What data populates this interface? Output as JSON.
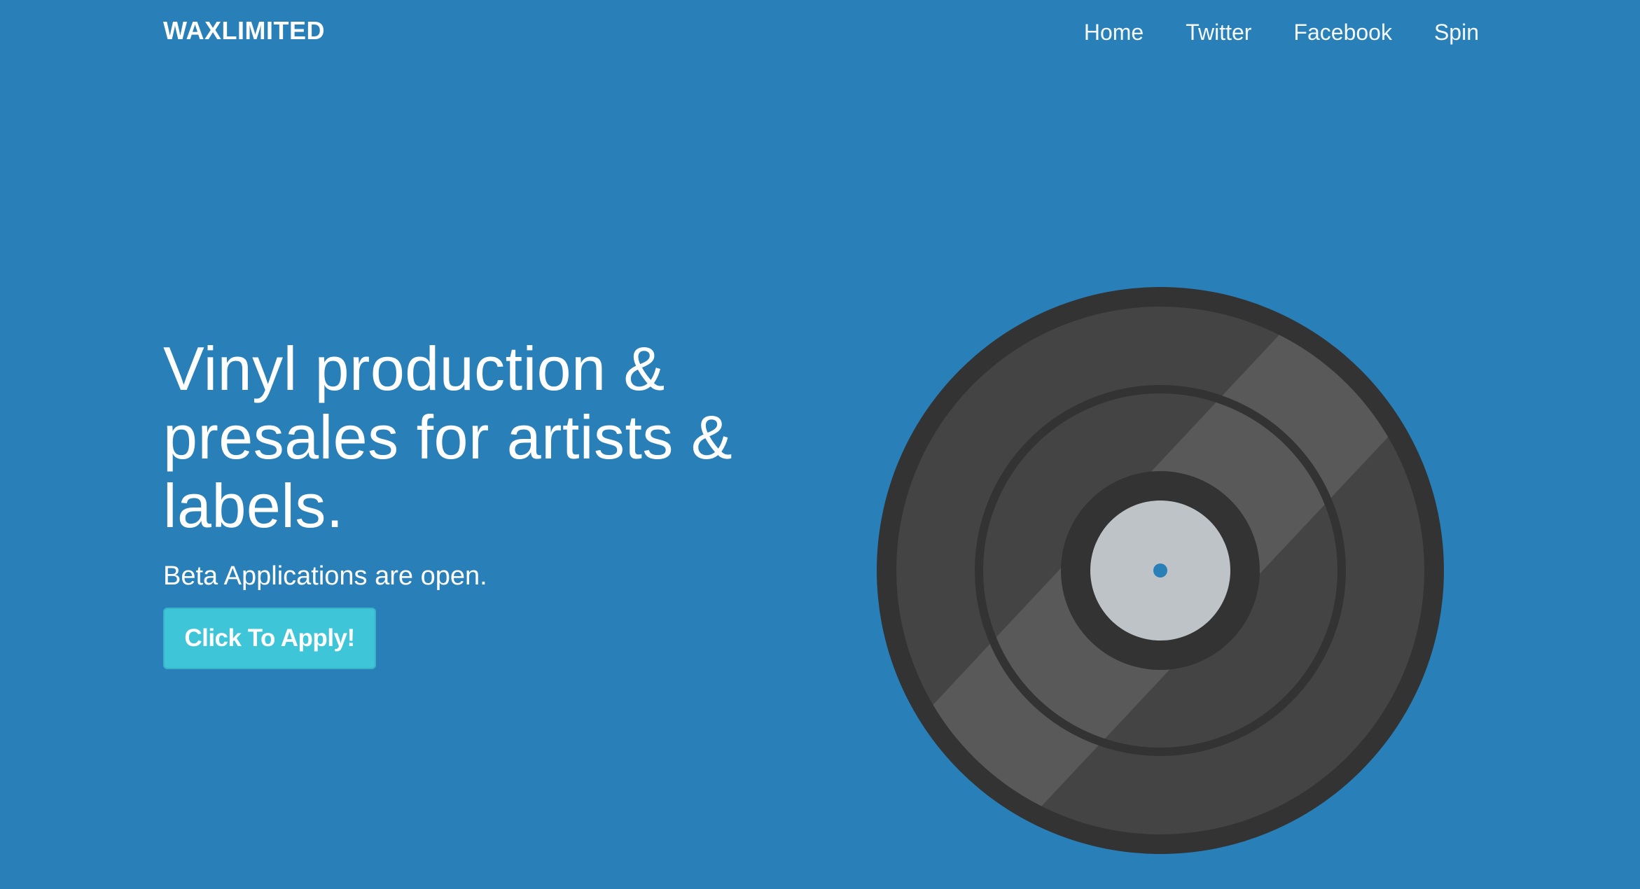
{
  "navbar": {
    "brand": "WAXLIMITED",
    "links": [
      {
        "label": "Home"
      },
      {
        "label": "Twitter"
      },
      {
        "label": "Facebook"
      },
      {
        "label": "Spin"
      }
    ]
  },
  "hero": {
    "title": "Vinyl production & presales for artists & labels.",
    "subtitle": "Beta Applications are open.",
    "cta_label": "Click To Apply!"
  },
  "illustration": {
    "icon": "vinyl-record-icon"
  },
  "colors": {
    "background": "#2980b9",
    "button": "#3ec6d8",
    "record_outer": "#333333",
    "record_body": "#444444",
    "record_shine": "#595959",
    "record_label": "#bdc3c7"
  }
}
